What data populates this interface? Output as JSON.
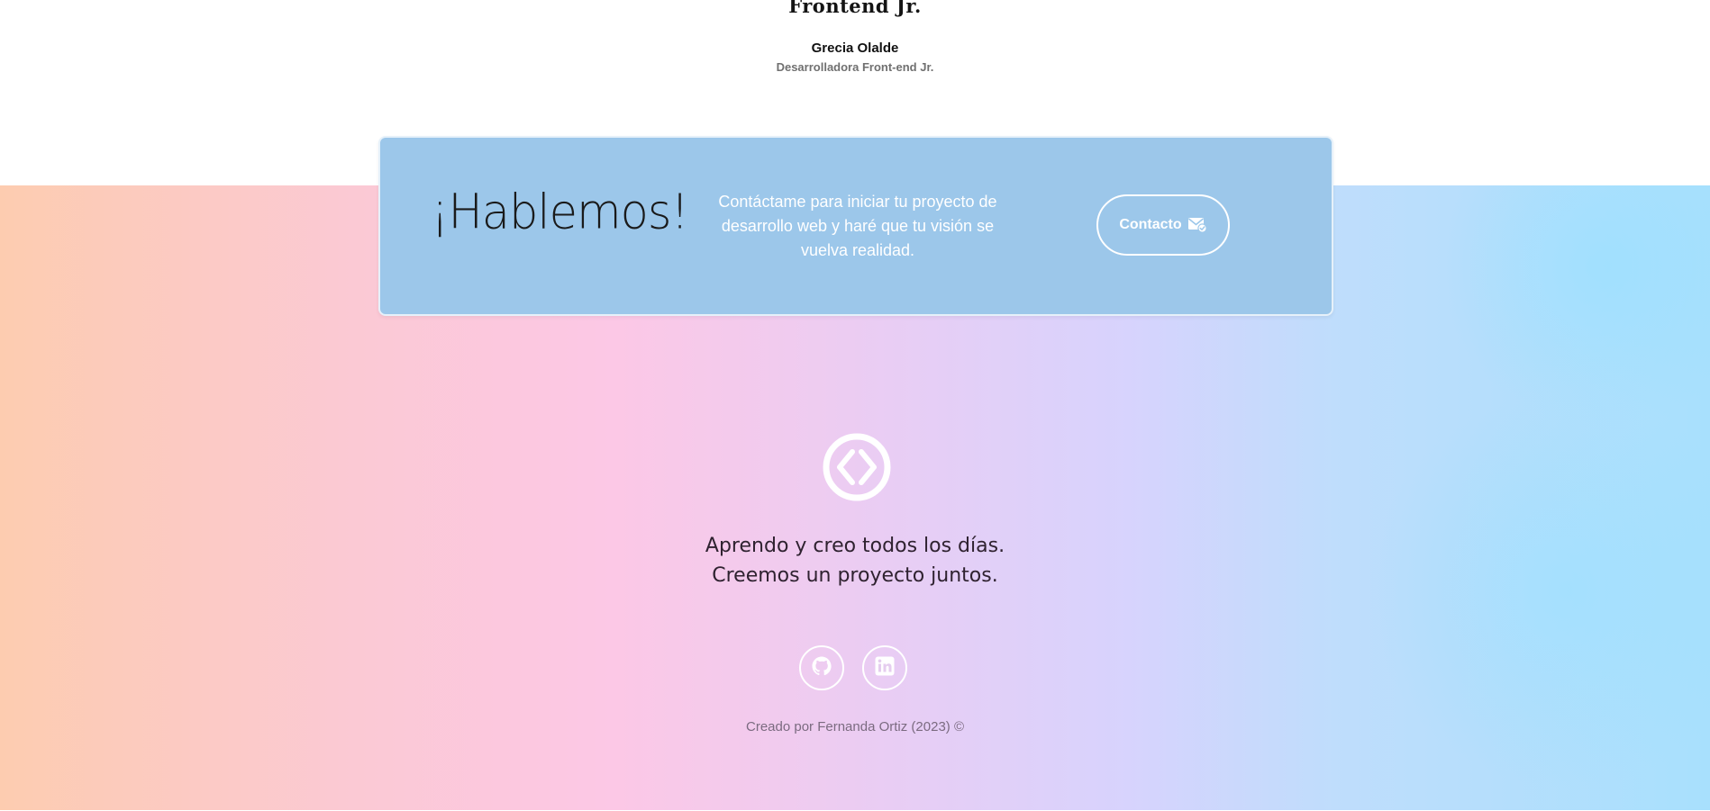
{
  "testimonial": {
    "heading": "Frontend Jr.",
    "name": "Grecia Olalde",
    "role": "Desarrolladora Front-end Jr."
  },
  "cta": {
    "title": "¡Hablemos!",
    "text": "Contáctame para iniciar tu proyecto de desarrollo web y haré que tu visión se vuelva realidad.",
    "button_label": "Contacto",
    "button_icon": "mail-check-icon"
  },
  "footer": {
    "logo_icon": "code-brackets-circle-icon",
    "tagline_line1": "Aprendo y creo todos los días.",
    "tagline_line2": "Creemos un proyecto juntos.",
    "social": [
      {
        "icon": "github-icon"
      },
      {
        "icon": "linkedin-icon"
      }
    ],
    "credit": "Creado por Fernanda Ortiz (2023) ©"
  },
  "colors": {
    "card_bg": "#9cc7ea",
    "gradient_start": "#fdccb0",
    "gradient_mid": "#fcc8e6",
    "gradient_end": "#a8e0fd"
  }
}
